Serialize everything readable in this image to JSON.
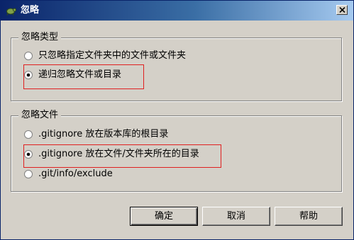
{
  "window": {
    "title": "忽略",
    "close_glyph": "×"
  },
  "group_type": {
    "legend": "忽略类型",
    "options": [
      {
        "label": "只忽略指定文件夹中的文件或文件夹",
        "selected": false
      },
      {
        "label": "递归忽略文件或目录",
        "selected": true
      }
    ]
  },
  "group_file": {
    "legend": "忽略文件",
    "options": [
      {
        "label": ".gitignore 放在版本库的根目录",
        "selected": false
      },
      {
        "label": ".gitignore 放在文件/文件夹所在的目录",
        "selected": true
      },
      {
        "label": ".git/info/exclude",
        "selected": false
      }
    ]
  },
  "buttons": {
    "ok": "确定",
    "cancel": "取消",
    "help": "帮助"
  },
  "colors": {
    "titlebar_start": "#0a246a",
    "titlebar_end": "#a6caf0",
    "dialog_bg": "#d4d0c8",
    "highlight_box": "#e02020"
  },
  "icons": {
    "title": "tortoise-git-icon",
    "close": "close-icon"
  }
}
